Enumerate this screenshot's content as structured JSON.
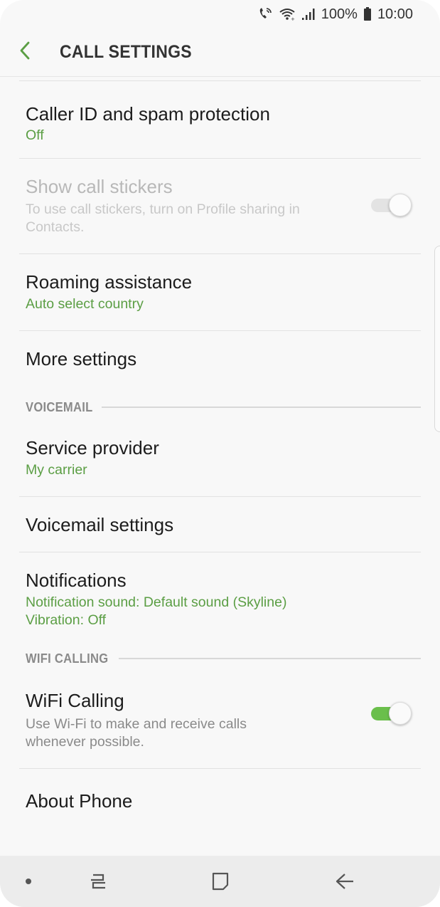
{
  "status_bar": {
    "battery_text": "100%",
    "time": "10:00",
    "icons": [
      "wifi-call-icon",
      "wifi-icon",
      "signal-icon",
      "battery-icon"
    ]
  },
  "header": {
    "title": "CALL SETTINGS",
    "back_icon": "chevron-left-icon"
  },
  "items": {
    "caller_id": {
      "title": "Caller ID and spam protection",
      "value": "Off"
    },
    "call_stickers": {
      "title": "Show call stickers",
      "description": "To use call stickers, turn on Profile sharing in Contacts.",
      "toggle_on": false,
      "enabled": false
    },
    "roaming": {
      "title": "Roaming assistance",
      "value": "Auto select country"
    },
    "more_settings": {
      "title": "More settings"
    },
    "service_provider": {
      "title": "Service provider",
      "value": "My carrier"
    },
    "voicemail_settings": {
      "title": "Voicemail settings"
    },
    "notifications": {
      "title": "Notifications",
      "value_line1": "Notification sound: Default sound (Skyline)",
      "value_line2": "Vibration: Off"
    },
    "wifi_calling": {
      "title": "WiFi Calling",
      "description": "Use Wi-Fi to make and receive calls whenever possible.",
      "toggle_on": true
    },
    "about_phone": {
      "title": "About Phone"
    }
  },
  "sections": {
    "voicemail": "VOICEMAIL",
    "wifi_calling": "WIFI CALLING"
  },
  "colors": {
    "accent_green": "#5b9e44",
    "toggle_on": "#6abf4b"
  },
  "nav_bar": {
    "icons": [
      "dot-icon",
      "recents-icon",
      "home-icon",
      "back-icon"
    ]
  }
}
